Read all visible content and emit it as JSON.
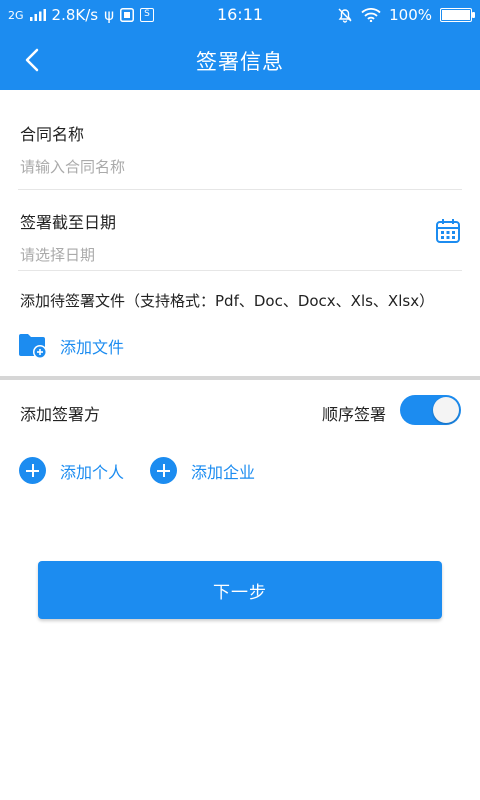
{
  "status_bar": {
    "network": "2G",
    "speed": "2.8K/s",
    "usb_symbol": "ψ",
    "sim_badge": "S",
    "time": "16:11",
    "battery": "100%"
  },
  "header": {
    "title": "签署信息"
  },
  "contract_name": {
    "label": "合同名称",
    "placeholder": "请输入合同名称"
  },
  "deadline": {
    "label": "签署截至日期",
    "placeholder": "请选择日期"
  },
  "file_section": {
    "label": "添加待签署文件（支持格式：Pdf、Doc、Docx、Xls、Xlsx）",
    "add_file_label": "添加文件"
  },
  "signers": {
    "label": "添加签署方",
    "sequential_label": "顺序签署",
    "sequential_enabled": true,
    "add_person_label": "添加个人",
    "add_company_label": "添加企业"
  },
  "next_button_label": "下一步",
  "colors": {
    "primary": "#1c8cf0",
    "placeholder": "#aaaaaa",
    "divider": "#e6e6e6"
  }
}
